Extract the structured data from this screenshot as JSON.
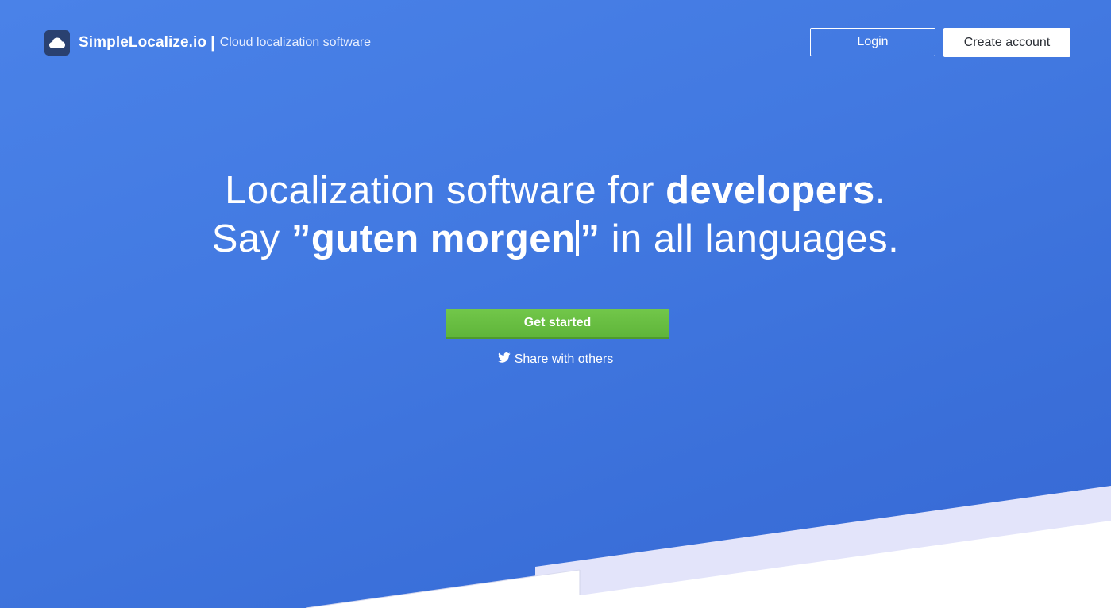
{
  "header": {
    "brand_name": "SimpleLocalize.io",
    "brand_separator": "|",
    "brand_tagline": "Cloud localization software",
    "logo_icon": "cloud-icon",
    "login_label": "Login",
    "create_account_label": "Create account"
  },
  "hero": {
    "line1_prefix": "Localization software for ",
    "line1_bold": "developers",
    "line1_suffix": ".",
    "line2_prefix": "Say ",
    "line2_open_quote": "”",
    "line2_typed": "guten morgen",
    "line2_close_quote": "”",
    "line2_suffix": " in all languages."
  },
  "cta": {
    "get_started_label": "Get started",
    "share_label": "Share with others",
    "share_icon": "twitter-icon"
  },
  "colors": {
    "hero_blue": "#4279e1",
    "cta_green": "#66bb3f",
    "logo_navy": "#2a4170",
    "band_lavender": "#e3e4fa"
  }
}
